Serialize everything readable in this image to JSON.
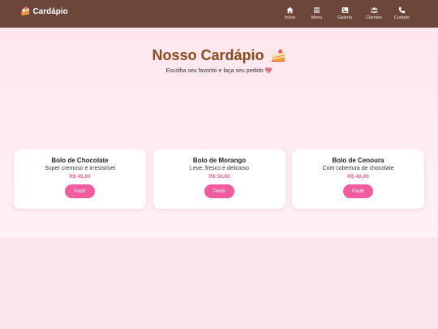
{
  "navbar": {
    "brand": "Cardápio",
    "brand_icon": "cake-icon",
    "items": [
      {
        "label": "Início",
        "icon": "home-icon"
      },
      {
        "label": "Menu",
        "icon": "bars-icon"
      },
      {
        "label": "Galeria",
        "icon": "image-icon"
      },
      {
        "label": "Clientes",
        "icon": "users-icon"
      },
      {
        "label": "Contato",
        "icon": "phone-icon"
      }
    ]
  },
  "hero": {
    "title": "Nosso Cardápio",
    "title_icon": "cake-icon",
    "subtitle": "Escolha seu favorito e faça seu pedido",
    "subtitle_icon": "heart-icon"
  },
  "cards": [
    {
      "title": "Bolo de Chocolate",
      "desc": "Super cremoso e irresistível",
      "price": "R$ 45,00",
      "button": "Pedir"
    },
    {
      "title": "Bolo de Morango",
      "desc": "Leve, fresco e delicioso",
      "price": "R$ 50,00",
      "button": "Pedir"
    },
    {
      "title": "Bolo de Cenoura",
      "desc": "Com cobertura de chocolate",
      "price": "R$ 40,00",
      "button": "Pedir"
    }
  ],
  "colors": {
    "navbar": "#6b4639",
    "title": "#8b4a1c",
    "accent": "#f25c9e",
    "price": "#e05b93",
    "background": "#fde6ec"
  }
}
